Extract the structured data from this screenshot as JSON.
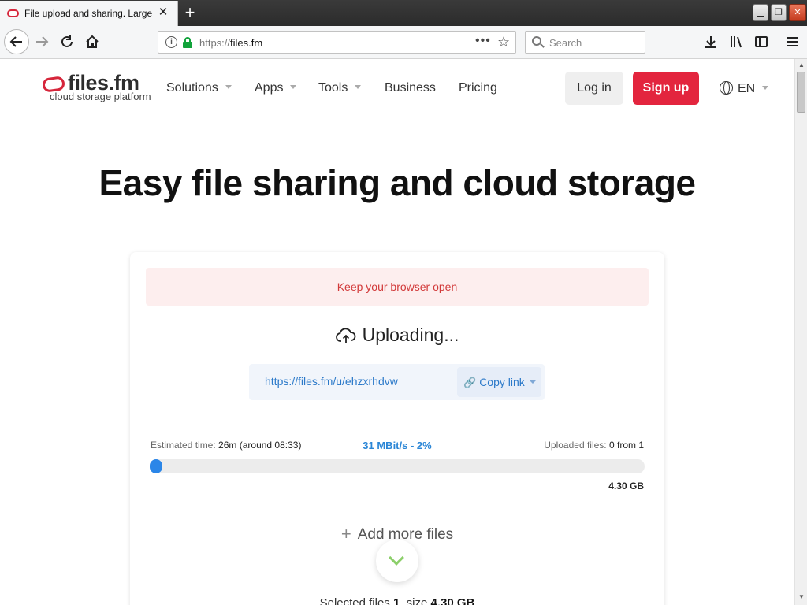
{
  "browser": {
    "tab_title": "File upload and sharing. Large file",
    "tab_close": "✕",
    "new_tab": "+",
    "url_protocol": "https://",
    "url_host": "files.fm",
    "search_placeholder": "Search",
    "window_controls": {
      "minimize": "▁",
      "maximize": "❐",
      "close": "✕"
    }
  },
  "site": {
    "logo_name": "files.fm",
    "logo_tagline": "cloud storage platform",
    "nav": [
      {
        "label": "Solutions",
        "has_dropdown": true
      },
      {
        "label": "Apps",
        "has_dropdown": true
      },
      {
        "label": "Tools",
        "has_dropdown": true
      },
      {
        "label": "Business",
        "has_dropdown": false
      },
      {
        "label": "Pricing",
        "has_dropdown": false
      }
    ],
    "login_label": "Log in",
    "signup_label": "Sign up",
    "language": "EN",
    "brand_color": "#e3253e"
  },
  "hero": {
    "title": "Easy file sharing and cloud storage"
  },
  "upload": {
    "notice": "Keep your browser open",
    "status": "Uploading...",
    "share_link": "https://files.fm/u/ehzxrhdvw",
    "copy_label": "Copy link",
    "estimated_label": "Estimated time:",
    "estimated_value": "26m (around 08:33)",
    "speed": "31 MBit/s - 2%",
    "uploaded_label": "Uploaded files:",
    "uploaded_value": "0 from 1",
    "progress_percent": 2,
    "total_size": "4.30 GB",
    "add_more_label": "Add more files",
    "selected_prefix": "Selected files",
    "selected_count": "1",
    "selected_size_label": ", size",
    "selected_size": "4.30 GB",
    "accent_color": "#2b86e8"
  }
}
